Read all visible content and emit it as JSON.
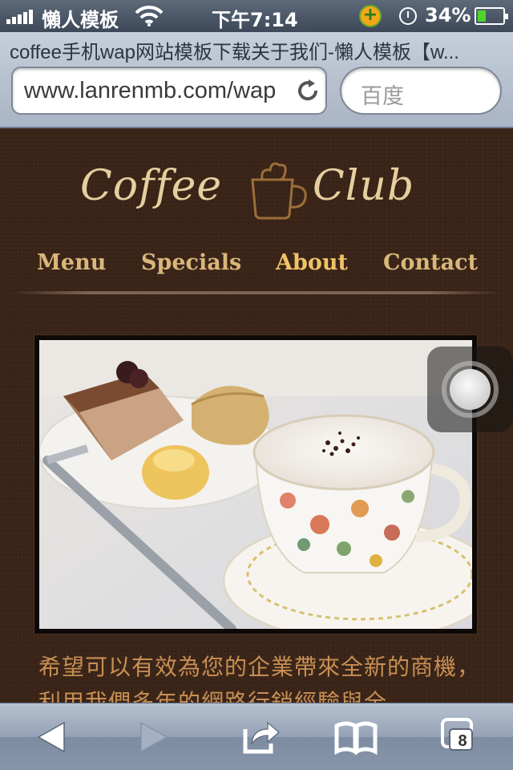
{
  "status_bar": {
    "carrier": "懶人模板",
    "time": "下午7:14",
    "battery_percent": "34%",
    "battery_level": 0.34,
    "icons": [
      "signal-bars-icon",
      "wifi-icon",
      "plus-badge-icon",
      "alarm-icon",
      "battery-icon"
    ]
  },
  "browser": {
    "page_title": "coffee手机wap网站模板下载关于我们-懶人模板【w...",
    "url": "www.lanrenmb.com/wap",
    "search_placeholder": "百度",
    "open_tabs": "8"
  },
  "site": {
    "logo_left": "Coffee",
    "logo_right": "Club",
    "nav": [
      {
        "label": "Menu"
      },
      {
        "label": "Specials"
      },
      {
        "label": "About",
        "active": true
      },
      {
        "label": "Contact"
      }
    ],
    "intro_text": "希望可以有效為您的企業帶來全新的商機，利用我們多年的網路行銷經驗與全"
  },
  "colors": {
    "page_background": "#3a2418",
    "logo": "#e6cf9f",
    "nav": "#d9b77a",
    "nav_active": "#f0c268",
    "intro_text": "#c88f52"
  },
  "toolbar_icons": [
    "back-arrow-icon",
    "forward-arrow-icon",
    "share-icon",
    "bookmarks-icon",
    "tabs-icon"
  ]
}
